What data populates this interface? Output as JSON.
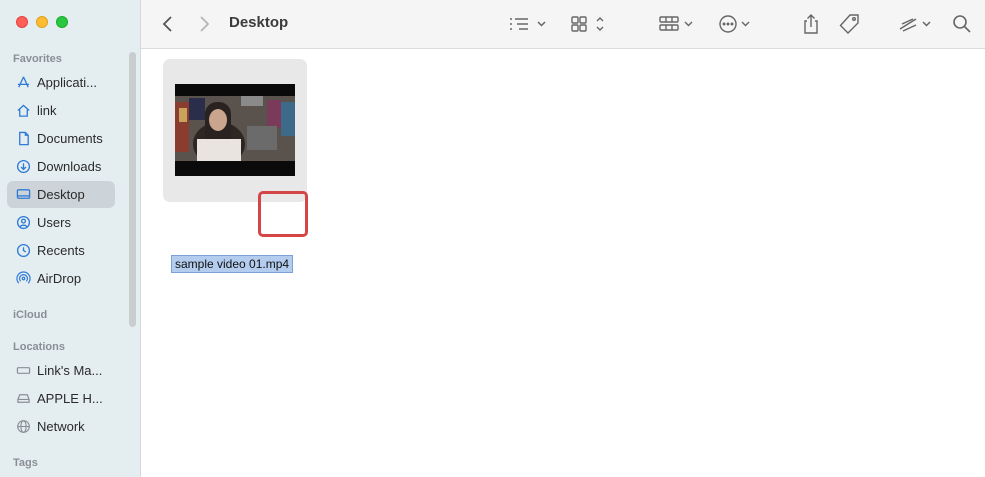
{
  "window": {
    "title": "Desktop"
  },
  "sidebar": {
    "favorites_title": "Favorites",
    "favorites": [
      {
        "label": "Applicati...",
        "icon": "applications-icon"
      },
      {
        "label": "link",
        "icon": "home-icon"
      },
      {
        "label": "Documents",
        "icon": "document-icon"
      },
      {
        "label": "Downloads",
        "icon": "download-icon"
      },
      {
        "label": "Desktop",
        "icon": "desktop-icon",
        "active": true
      },
      {
        "label": "Users",
        "icon": "user-icon"
      },
      {
        "label": "Recents",
        "icon": "clock-icon"
      },
      {
        "label": "AirDrop",
        "icon": "airdrop-icon"
      }
    ],
    "icloud_title": "iCloud",
    "locations_title": "Locations",
    "locations": [
      {
        "label": "Link's Ma...",
        "icon": "computer-icon"
      },
      {
        "label": "APPLE H...",
        "icon": "drive-icon"
      },
      {
        "label": "Network",
        "icon": "globe-icon"
      }
    ],
    "tags_title": "Tags"
  },
  "toolbar": {
    "icons": [
      "back-icon",
      "forward-icon",
      "list-view-icon",
      "icon-view-icon",
      "group-icon",
      "more-icon",
      "share-icon",
      "tag-icon",
      "markup-icon",
      "search-icon"
    ]
  },
  "content": {
    "file": {
      "name": "sample video 01.mp4",
      "type": "video thumbnail"
    }
  },
  "colors": {
    "sidebar_bg": "#e4eef1",
    "selection": "#b4cdef",
    "highlight": "#d64545"
  }
}
